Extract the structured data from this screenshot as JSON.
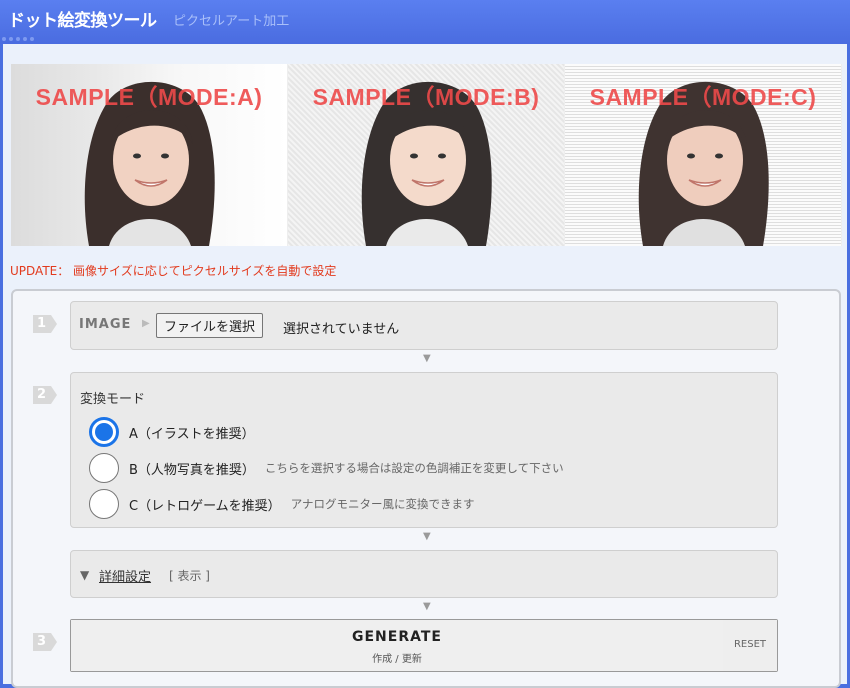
{
  "header": {
    "title": "ドット絵変換ツール",
    "subtitle": "ピクセルアート加工"
  },
  "samples": [
    {
      "label": "SAMPLE（MODE:A)"
    },
    {
      "label": "SAMPLE（MODE:B)"
    },
    {
      "label": "SAMPLE（MODE:C)"
    }
  ],
  "update_notice": "UPDATE： 画像サイズに応じてピクセルサイズを自動で設定",
  "steps": {
    "step1": {
      "number": "1",
      "label": "IMAGE",
      "file_button": "ファイルを選択",
      "file_status": "選択されていません"
    },
    "step2": {
      "number": "2",
      "title": "変換モード",
      "options": [
        {
          "label": "A（イラストを推奨）",
          "note": "",
          "selected": true
        },
        {
          "label": "B（人物写真を推奨）",
          "note": "こちらを選択する場合は設定の色調補正を変更して下さい",
          "selected": false
        },
        {
          "label": "C（レトロゲームを推奨）",
          "note": "アナログモニター風に変換できます",
          "selected": false
        }
      ]
    },
    "details": {
      "link": "詳細設定",
      "toggle": "[ 表示 ]"
    },
    "step3": {
      "number": "3",
      "generate_label": "GENERATE",
      "generate_sub": "作成 / 更新",
      "reset_label": "RESET"
    }
  },
  "colors": {
    "header": "#4a6fe0",
    "panel": "#ebf1fb",
    "update_text": "#e23a1d",
    "sample_label": "#ee4a4a",
    "radio_selected": "#1b74e8"
  },
  "icons": {
    "flow_arrow": "▼",
    "image_arrow": "▶",
    "details_toggle": "▼"
  }
}
